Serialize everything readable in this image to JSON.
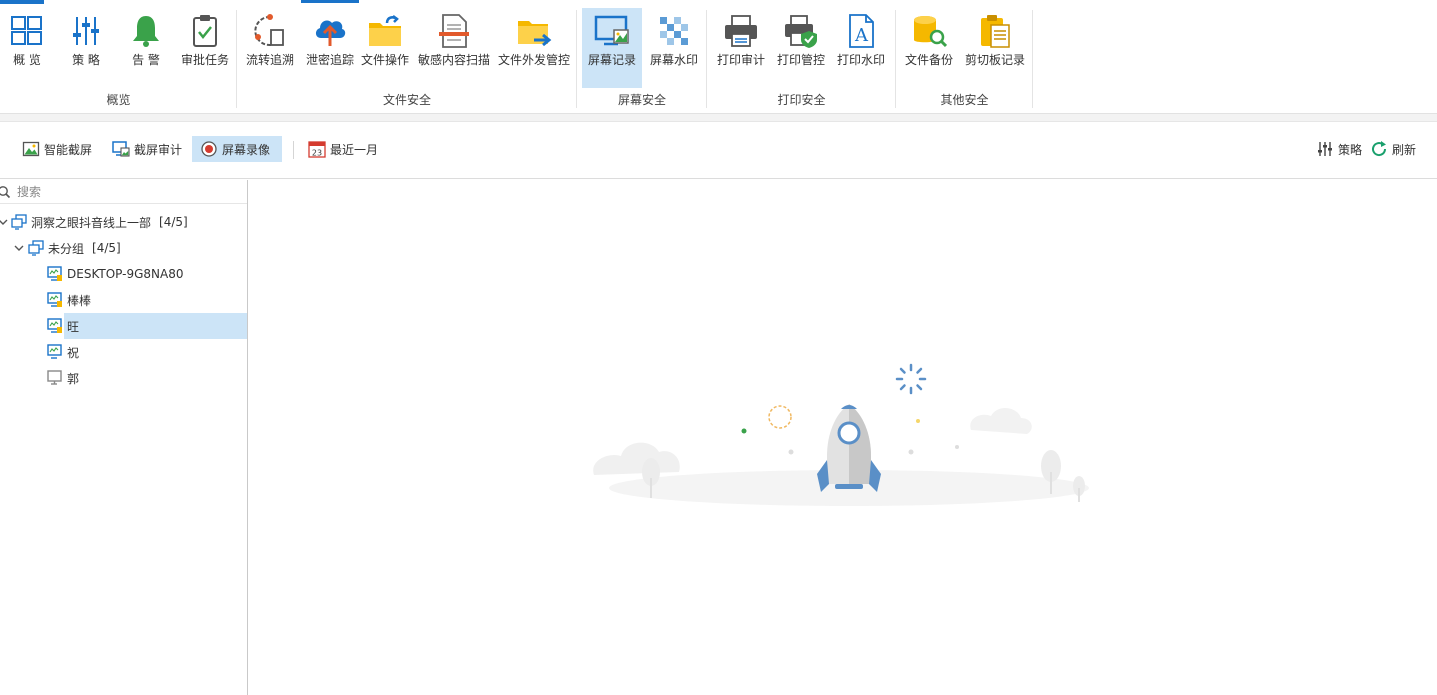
{
  "ribbon": {
    "groups": [
      {
        "label": "概览",
        "buttons": [
          {
            "label": "概 览",
            "icon": "dashboard-grid-icon"
          },
          {
            "label": "策 略",
            "icon": "sliders-icon"
          },
          {
            "label": "告 警",
            "icon": "bell-icon"
          },
          {
            "label": "审批任务",
            "icon": "clipboard-check-icon"
          }
        ]
      },
      {
        "label": "文件安全",
        "buttons": [
          {
            "label": "流转追溯",
            "icon": "flow-trace-icon"
          },
          {
            "label": "泄密追踪",
            "icon": "cloud-upload-icon"
          },
          {
            "label": "文件操作",
            "icon": "folder-arrow-icon"
          },
          {
            "label": "敏感内容扫描",
            "icon": "document-scan-icon"
          },
          {
            "label": "文件外发管控",
            "icon": "folder-send-icon"
          }
        ]
      },
      {
        "label": "屏幕安全",
        "buttons": [
          {
            "label": "屏幕记录",
            "icon": "monitor-image-icon"
          },
          {
            "label": "屏幕水印",
            "icon": "checker-watermark-icon"
          }
        ]
      },
      {
        "label": "打印安全",
        "buttons": [
          {
            "label": "打印审计",
            "icon": "printer-icon"
          },
          {
            "label": "打印管控",
            "icon": "printer-shield-icon"
          },
          {
            "label": "打印水印",
            "icon": "document-a-icon"
          }
        ]
      },
      {
        "label": "其他安全",
        "buttons": [
          {
            "label": "文件备份",
            "icon": "database-search-icon"
          },
          {
            "label": "剪切板记录",
            "icon": "clipboard-icon"
          }
        ]
      }
    ],
    "active_button": "屏幕记录"
  },
  "toolbar": {
    "smart_capture": "智能截屏",
    "capture_audit": "截屏审计",
    "screen_recording": "屏幕录像",
    "date_range": "最近一月",
    "calendar_day": "23",
    "policy": "策略",
    "refresh": "刷新"
  },
  "sidebar": {
    "search_placeholder": "搜索",
    "tree": {
      "root": {
        "label": "洞察之眼抖音线上一部",
        "count": "[4/5]"
      },
      "group": {
        "label": "未分组",
        "count": "[4/5]"
      },
      "devices": [
        {
          "label": "DESKTOP-9G8NA80",
          "online": true
        },
        {
          "label": "棒棒",
          "online": true
        },
        {
          "label": "旺",
          "online": true,
          "selected": true
        },
        {
          "label": "祝",
          "online": true
        },
        {
          "label": "郭",
          "online": false
        }
      ]
    }
  },
  "colors": {
    "accent": "#1a73c9",
    "selection": "#cce4f7",
    "bell_green": "#3aa24a",
    "folder_yellow": "#f5b800",
    "record_red": "#d43b2f"
  }
}
